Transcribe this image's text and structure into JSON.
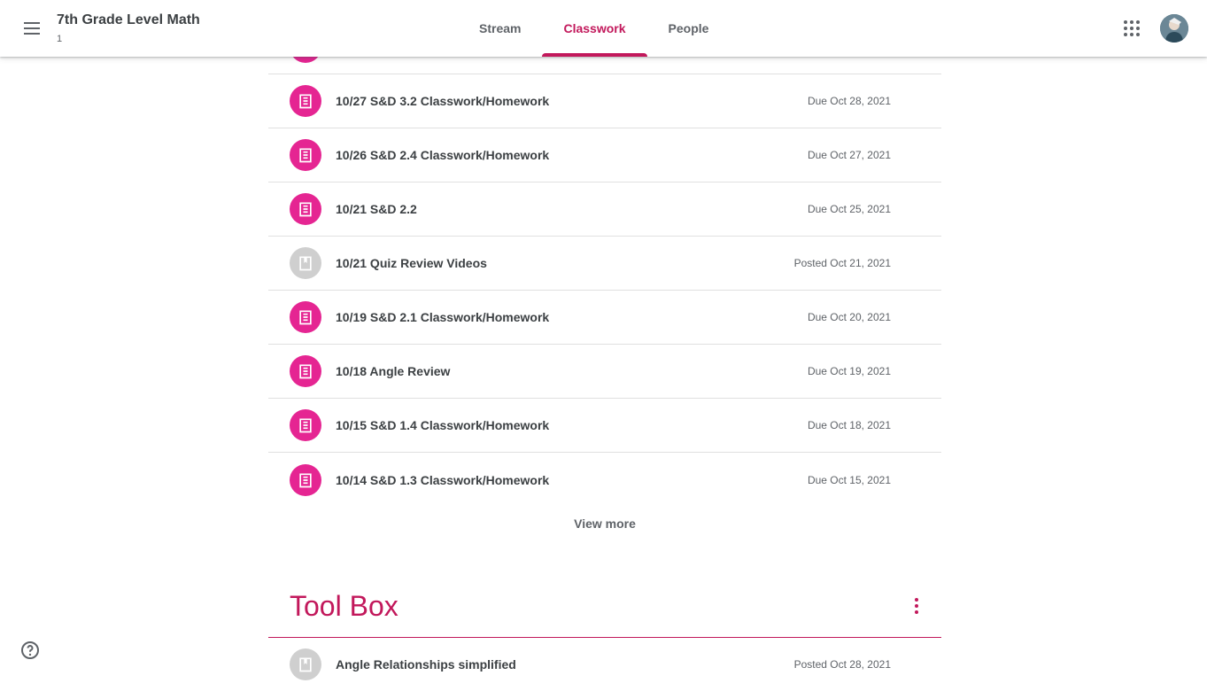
{
  "header": {
    "class_title": "7th Grade Level Math",
    "class_section": "1",
    "tabs": [
      {
        "label": "Stream"
      },
      {
        "label": "Classwork"
      },
      {
        "label": "People"
      }
    ]
  },
  "classwork": {
    "items": [
      {
        "type": "assignment",
        "title": "10/27 S&D 3.2 Classwork/Homework",
        "date": "Due Oct 28, 2021"
      },
      {
        "type": "assignment",
        "title": "10/26 S&D 2.4 Classwork/Homework",
        "date": "Due Oct 27, 2021"
      },
      {
        "type": "assignment",
        "title": "10/21 S&D 2.2",
        "date": "Due Oct 25, 2021"
      },
      {
        "type": "material",
        "title": "10/21 Quiz Review Videos",
        "date": "Posted Oct 21, 2021"
      },
      {
        "type": "assignment",
        "title": "10/19 S&D 2.1 Classwork/Homework",
        "date": "Due Oct 20, 2021"
      },
      {
        "type": "assignment",
        "title": "10/18 Angle Review",
        "date": "Due Oct 19, 2021"
      },
      {
        "type": "assignment",
        "title": "10/15 S&D 1.4 Classwork/Homework",
        "date": "Due Oct 18, 2021"
      },
      {
        "type": "assignment",
        "title": "10/14 S&D 1.3 Classwork/Homework",
        "date": "Due Oct 15, 2021"
      }
    ],
    "view_more": "View more"
  },
  "topic": {
    "title": "Tool Box",
    "items": [
      {
        "type": "material",
        "title": "Angle Relationships simplified",
        "date": "Posted Oct 28, 2021"
      }
    ]
  },
  "colors": {
    "accent": "#c2185b",
    "assignment_icon_bg": "#e52592",
    "material_icon_bg": "#cfcfcf"
  }
}
